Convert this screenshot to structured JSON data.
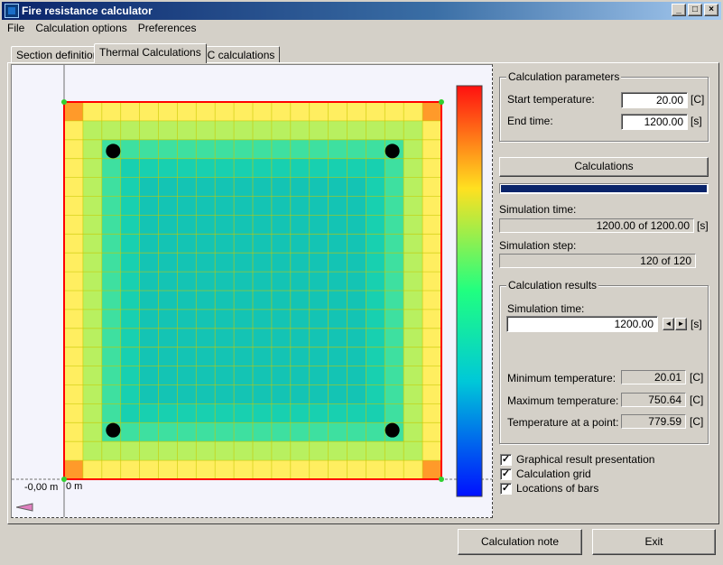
{
  "window": {
    "title": "Fire resistance calculator",
    "min": "_",
    "max": "□",
    "close": "×"
  },
  "menu": [
    "File",
    "Calculation options",
    "Preferences"
  ],
  "tabs": [
    "Section definition",
    "Thermal Calculations",
    "RC calculations"
  ],
  "canvas": {
    "x_origin_label": "0 m",
    "y_origin_label": "-0,00 m",
    "grid_rows": 20,
    "grid_cols": 20,
    "bar_count": 4
  },
  "params": {
    "title": "Calculation parameters",
    "start_temp_label": "Start temperature:",
    "start_temp_value": "20.00",
    "start_temp_unit": "[C]",
    "end_time_label": "End time:",
    "end_time_value": "1200.00",
    "end_time_unit": "[s]"
  },
  "calc_button": "Calculations",
  "progress": 1.0,
  "sim_time": {
    "label": "Simulation time:",
    "value": "1200.00 of 1200.00",
    "unit": "[s]"
  },
  "sim_step": {
    "label": "Simulation step:",
    "value": "120 of 120"
  },
  "results": {
    "title": "Calculation results",
    "sim_time_label": "Simulation time:",
    "sim_time_value": "1200.00",
    "sim_time_unit": "[s]",
    "spin_left": "◄",
    "spin_right": "►",
    "min_label": "Minimum temperature:",
    "min_value": "20.01",
    "max_label": "Maximum temperature:",
    "max_value": "750.64",
    "point_label": "Temperature at a point:",
    "point_value": "779.59",
    "unit": "[C]"
  },
  "options": [
    {
      "label": "Graphical result presentation",
      "checked": true
    },
    {
      "label": "Calculation grid",
      "checked": true
    },
    {
      "label": "Locations of bars",
      "checked": true
    }
  ],
  "check_mark": "✓",
  "buttons": {
    "note": "Calculation note",
    "exit": "Exit"
  },
  "colors": {
    "section_border": "#ff0000",
    "gridline": "#c8c800",
    "bar": "#000000"
  }
}
